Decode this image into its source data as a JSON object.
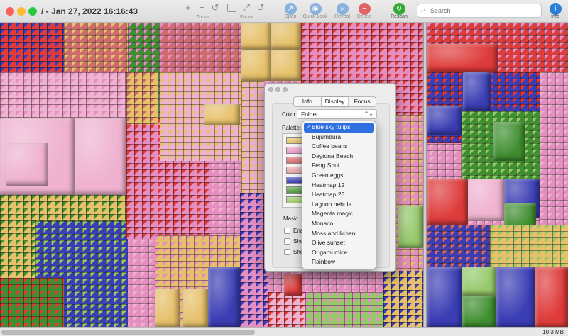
{
  "window": {
    "title": "/ - Jan 27, 2022 16:16:43"
  },
  "toolbar": {
    "zoom_in_glyph": "+",
    "zoom_out_glyph": "−",
    "zoom_reset_glyph": "↺",
    "zoom_label": "Zoom",
    "focus_label": "Focus",
    "open_label": "Open",
    "quicklook_label": "Quick Look",
    "reveal_label": "Reveal",
    "delete_label": "Delete",
    "rescan_label": "Rescan",
    "search_placeholder": "Search",
    "info_label": "Info",
    "info_glyph": "i"
  },
  "icons": {
    "close": "close-icon",
    "minimize": "minimize-icon",
    "zoom_window": "fullscreen-icon",
    "search": "search-icon",
    "rescan": "refresh-icon",
    "info": "info-icon"
  },
  "colors": {
    "traffic_red": "#fe5f57",
    "traffic_yellow": "#febc2e",
    "traffic_green": "#28c840",
    "accent_blue": "#2f6fe0",
    "rescan_green": "#36a937",
    "info_blue": "#2a7fd8",
    "delete_red": "#e16363",
    "disabled_blue": "#8ab2de"
  },
  "inspector": {
    "tabs": [
      "Info",
      "Display",
      "Focus"
    ],
    "selected_tab": "Display",
    "color_by_label": "Color by:",
    "color_by_value": "Folder",
    "palette_label": "Palette:",
    "mask_label": "Mask:",
    "checkbox_1_fragment": "Ena",
    "checkbox_2_fragment": "Sho",
    "checkbox_3_fragment": "Sho",
    "palette_swatch_colors": [
      "#e8c36b",
      "#e89ac7",
      "#d86a6a",
      "#e4a3a3",
      "#3b3fb4",
      "#4e9a3c",
      "#9fcb6a"
    ]
  },
  "palette_menu": {
    "selected": "Blue sky tulips",
    "items": [
      "Blue sky tulips",
      "Bujumbura",
      "Coffee beans",
      "Daytona Beach",
      "Feng Shui",
      "Green eggs",
      "Heatmap 12",
      "Heatmap 23",
      "Lagoon nebula",
      "Magenta magic",
      "Monaco",
      "Moss and lichen",
      "Olive sunset",
      "Origami mice",
      "Rainbow"
    ]
  },
  "status": {
    "size": "10.3 MB"
  },
  "treemap_colors": {
    "pink": "#e58fc0",
    "lightpink": "#efb2cf",
    "gold": "#e6c06a",
    "blue": "#3a3db3",
    "red": "#de3b3b",
    "green": "#3f8e2f",
    "lightgreen": "#95c96a",
    "rose": "#cf6a6e"
  }
}
